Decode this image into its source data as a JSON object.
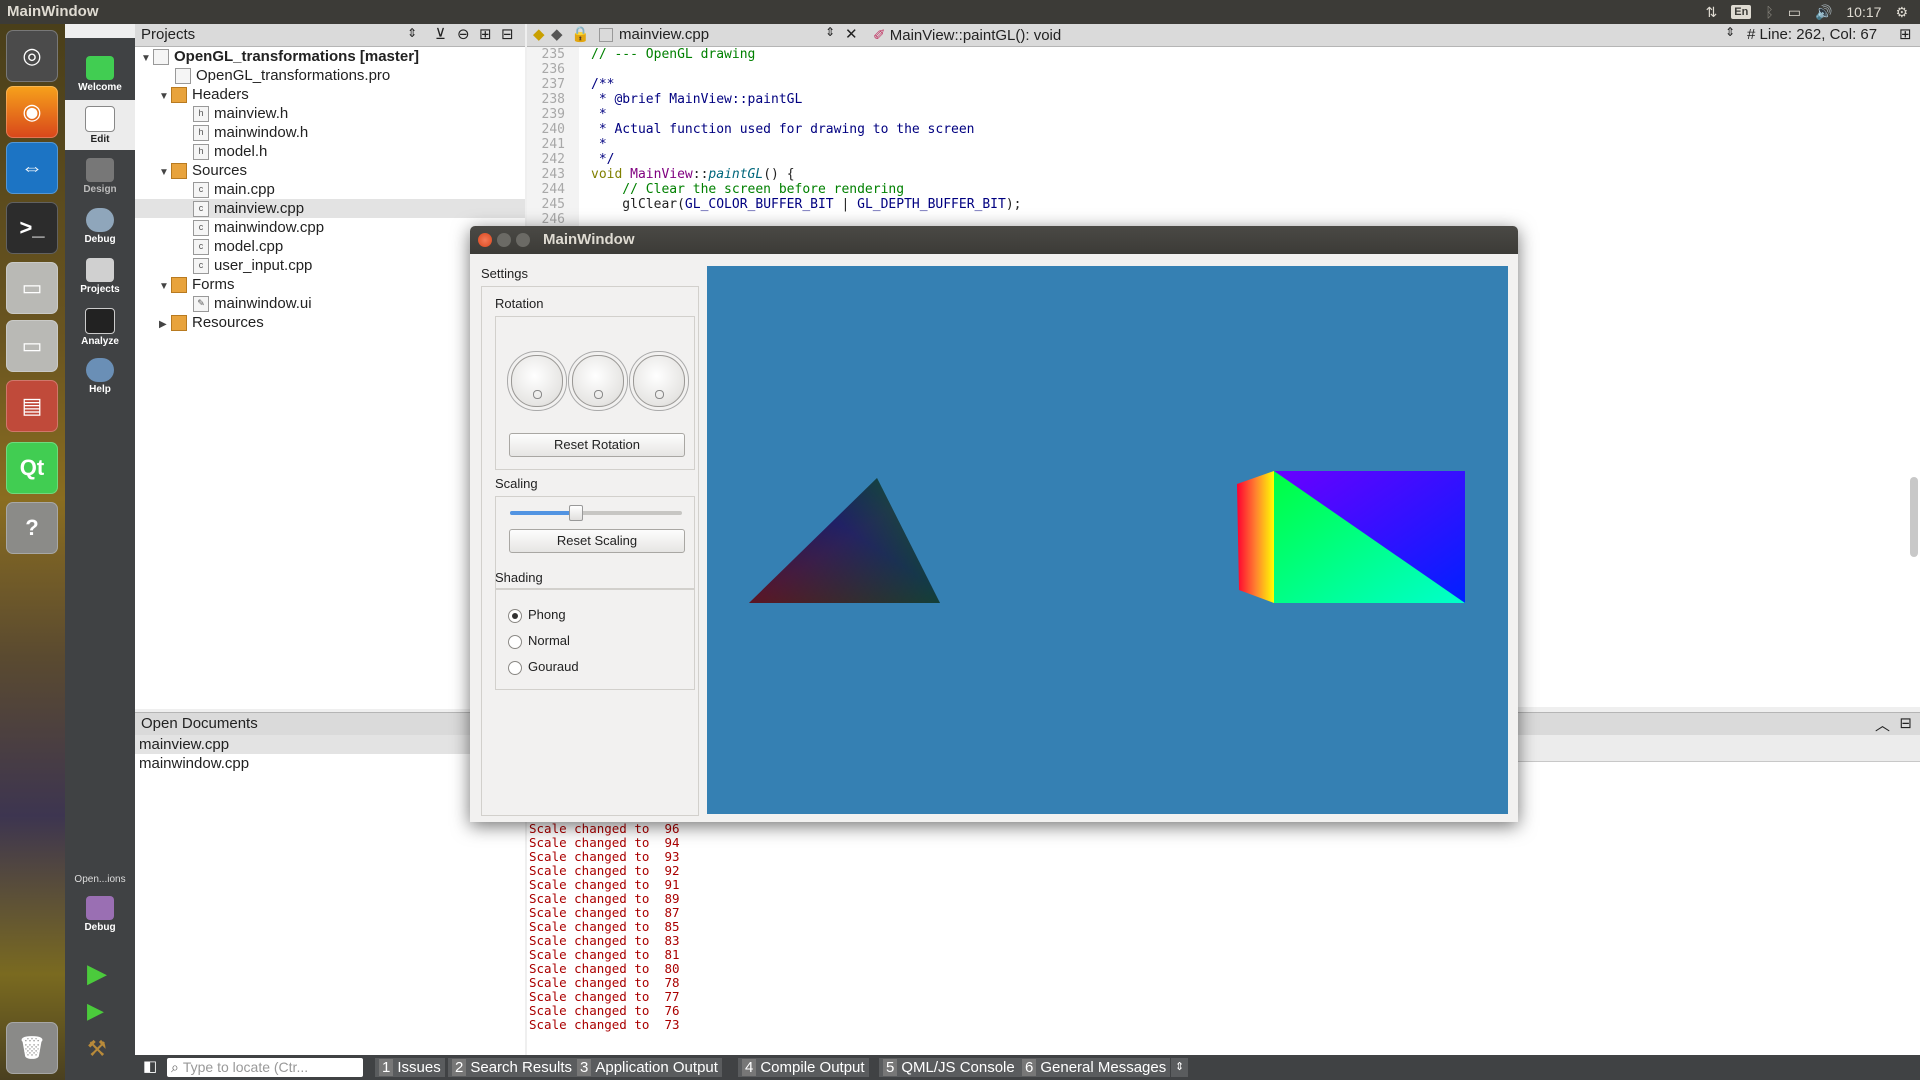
{
  "top_panel": {
    "title": "MainWindow",
    "clock": "10:17",
    "lang": "En"
  },
  "mode_bar": {
    "modes": [
      {
        "label": "Welcome"
      },
      {
        "label": "Edit"
      },
      {
        "label": "Design"
      },
      {
        "label": "Debug"
      },
      {
        "label": "Projects"
      },
      {
        "label": "Analyze"
      },
      {
        "label": "Help"
      }
    ],
    "kit_label": "Open...ions",
    "kit_mode": "Debug"
  },
  "projects": {
    "header": "Projects",
    "tree": [
      {
        "label": "OpenGL_transformations [master]"
      },
      {
        "label": "OpenGL_transformations.pro"
      },
      {
        "label": "Headers"
      },
      {
        "label": "mainview.h"
      },
      {
        "label": "mainwindow.h"
      },
      {
        "label": "model.h"
      },
      {
        "label": "Sources"
      },
      {
        "label": "main.cpp"
      },
      {
        "label": "mainview.cpp"
      },
      {
        "label": "mainwindow.cpp"
      },
      {
        "label": "model.cpp"
      },
      {
        "label": "user_input.cpp"
      },
      {
        "label": "Forms"
      },
      {
        "label": "mainwindow.ui"
      },
      {
        "label": "Resources"
      }
    ]
  },
  "open_documents": {
    "header": "Open Documents",
    "items": [
      "mainview.cpp",
      "mainwindow.cpp"
    ]
  },
  "editor": {
    "file": "mainview.cpp",
    "symbol": "MainView::paintGL(): void",
    "position": "Line: 262, Col: 67",
    "lines": [
      {
        "n": "235",
        "text": "// --- OpenGL drawing"
      },
      {
        "n": "236",
        "text": ""
      },
      {
        "n": "237",
        "text": "/**"
      },
      {
        "n": "238",
        "text": " * @brief MainView::paintGL"
      },
      {
        "n": "239",
        "text": " *"
      },
      {
        "n": "240",
        "text": " * Actual function used for drawing to the screen"
      },
      {
        "n": "241",
        "text": " *"
      },
      {
        "n": "242",
        "text": " */"
      },
      {
        "n": "243",
        "text_kw": "void ",
        "text_cls": "MainView",
        "text_sep": "::",
        "text_fn": "paintGL",
        "text_rest": "() {"
      },
      {
        "n": "244",
        "text": "    // Clear the screen before rendering"
      },
      {
        "n": "245",
        "text_pre": "    glClear(",
        "text_c1": "GL_COLOR_BUFFER_BIT",
        "text_mid": " | ",
        "text_c2": "GL_DEPTH_BUFFER_BIT",
        "text_post": ");"
      },
      {
        "n": "246",
        "text": ""
      }
    ]
  },
  "output": {
    "lines": [
      "Scale changed to  96",
      "Scale changed to  94",
      "Scale changed to  93",
      "Scale changed to  92",
      "Scale changed to  91",
      "Scale changed to  89",
      "Scale changed to  87",
      "Scale changed to  85",
      "Scale changed to  83",
      "Scale changed to  81",
      "Scale changed to  80",
      "Scale changed to  78",
      "Scale changed to  77",
      "Scale changed to  76",
      "Scale changed to  73"
    ]
  },
  "bottom_bar": {
    "locate_placeholder": "Type to locate (Ctr...",
    "tabs": [
      {
        "num": "1",
        "label": "Issues"
      },
      {
        "num": "2",
        "label": "Search Results"
      },
      {
        "num": "3",
        "label": "Application Output"
      },
      {
        "num": "4",
        "label": "Compile Output"
      },
      {
        "num": "5",
        "label": "QML/JS Console"
      },
      {
        "num": "6",
        "label": "General Messages"
      }
    ]
  },
  "app_window": {
    "title": "MainWindow",
    "settings_label": "Settings",
    "rotation_label": "Rotation",
    "reset_rotation": "Reset Rotation",
    "scaling_label": "Scaling",
    "scaling_value": 0.38,
    "reset_scaling": "Reset Scaling",
    "shading_label": "Shading",
    "shading_options": [
      "Phong",
      "Normal",
      "Gouraud"
    ],
    "shading_selected": "Phong",
    "gl_background": "#3580b3"
  }
}
